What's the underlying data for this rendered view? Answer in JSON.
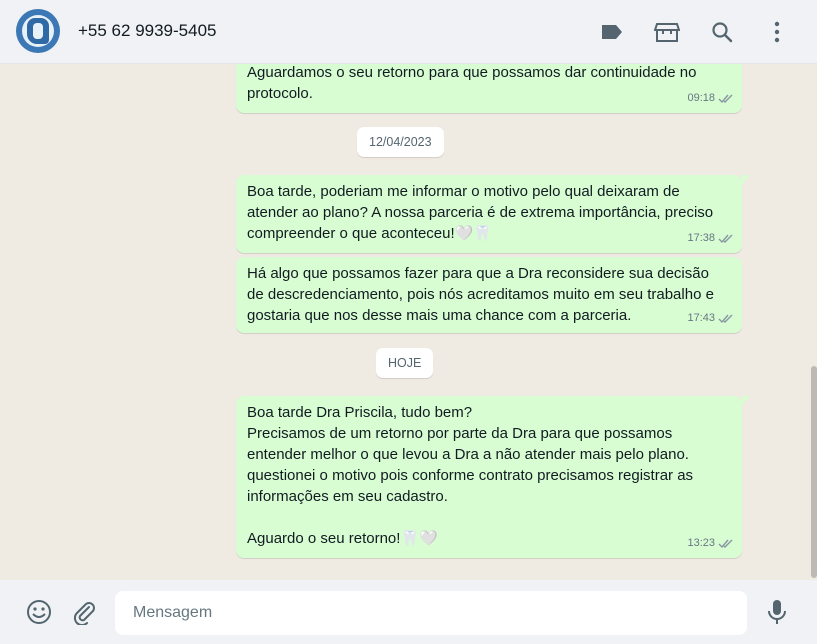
{
  "header": {
    "contact_name": "+55 62 9939-5405",
    "icons": [
      "label-icon",
      "catalog-icon",
      "search-icon",
      "menu-icon"
    ]
  },
  "messages": [
    {
      "text": "Aguardamos o seu retorno para que possamos dar continuidade no\nprotocolo.",
      "time": "09:18"
    },
    {
      "text": "Boa tarde, poderiam me informar o motivo pelo qual deixaram de\natender ao plano? A nossa parceria é de extrema importância, preciso\ncompreender o que aconteceu!",
      "emoji": "🤍🦷",
      "time": "17:38"
    },
    {
      "text": "Há algo que possamos fazer para que a Dra reconsidere sua decisão\nde descredenciamento, pois nós acreditamos muito em seu trabalho e\ngostaria que nos desse mais uma chance com a parceria.",
      "time": "17:43"
    },
    {
      "text": "Boa tarde Dra Priscila, tudo bem?\nPrecisamos de um retorno por parte da Dra para que possamos\nentender melhor o que levou a Dra a não atender mais pelo plano.\nquestionei o motivo pois conforme contrato precisamos registrar as\ninformações em seu cadastro.\n\nAguardo o seu retorno!",
      "emoji": "🦷🤍",
      "time": "13:23"
    }
  ],
  "dates": [
    "12/04/2023",
    "HOJE"
  ],
  "composer": {
    "placeholder": "Mensagem"
  },
  "colors": {
    "outgoing_bubble": "#d9fdd3",
    "chat_background": "#efeae2",
    "read_ticks": "#8696a0"
  }
}
